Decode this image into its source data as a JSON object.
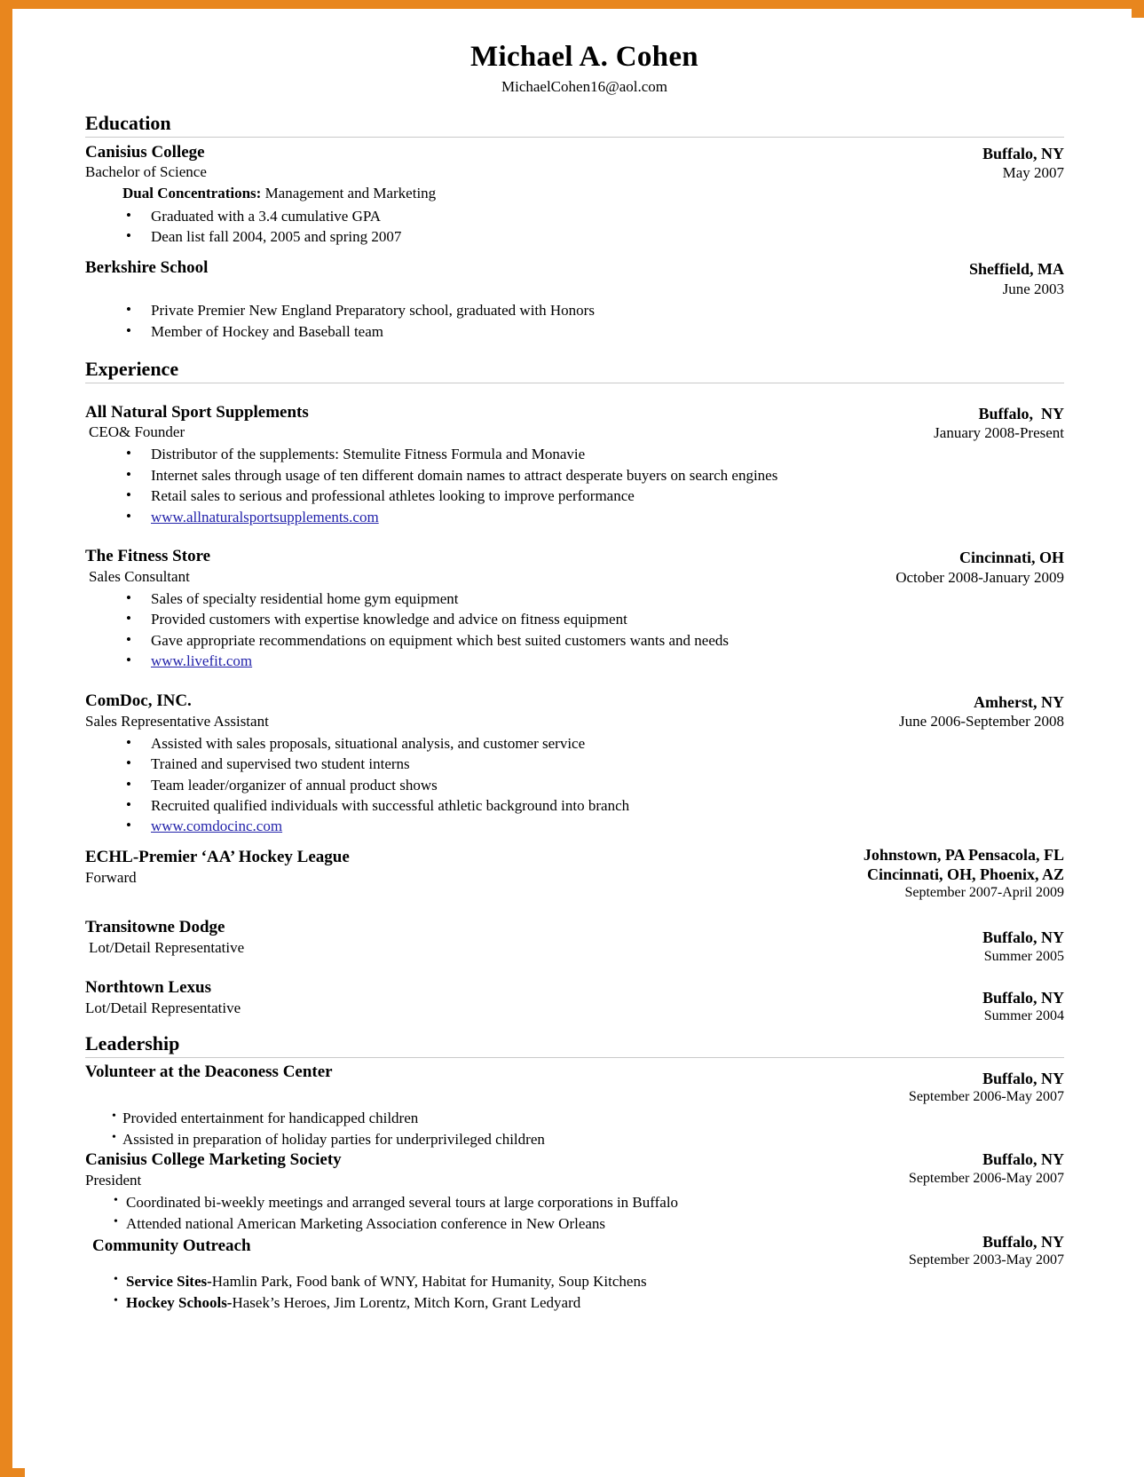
{
  "document": {
    "name": "Michael A. Cohen",
    "email": "MichaelCohen16@aol.com",
    "frame_color": "#e8861e",
    "link_color": "#2222aa"
  },
  "sections": {
    "education": {
      "title": "Education",
      "entries": [
        {
          "org": "Canisius College",
          "role": "Bachelor of Science",
          "location": "Buffalo, NY",
          "date": "May 2007",
          "sub_label": "Dual Concentrations:",
          "sub_text": " Management and Marketing",
          "bullets": [
            "Graduated with a 3.4 cumulative GPA",
            "Dean list fall 2004, 2005 and spring 2007"
          ]
        },
        {
          "org": "Berkshire School",
          "role": "",
          "location": "Sheffield, MA",
          "date": "June 2003",
          "bullets": [
            "Private Premier New England Preparatory school, graduated with Honors",
            "Member of Hockey and Baseball team"
          ]
        }
      ]
    },
    "experience": {
      "title": "Experience",
      "entries": [
        {
          "org": "All Natural Sport Supplements",
          "role": "CEO& Founder",
          "location": "Buffalo,  NY",
          "date": "January 2008-Present",
          "bullets": [
            "Distributor of the supplements: Stemulite Fitness Formula and Monavie",
            "Internet sales through usage of ten different domain names to attract desperate buyers on search engines",
            "Retail sales to serious and professional athletes looking to improve performance"
          ],
          "link": "www.allnaturalsportsupplements.com"
        },
        {
          "org": "The Fitness Store",
          "role": "Sales Consultant",
          "location": "Cincinnati, OH",
          "date": "October 2008-January 2009",
          "bullets": [
            "Sales of specialty residential home gym equipment",
            "Provided customers with expertise knowledge and advice on fitness equipment",
            "Gave appropriate recommendations on equipment which best suited customers wants and needs"
          ],
          "link": "www.livefit.com"
        },
        {
          "org": "ComDoc, INC.",
          "role": "Sales Representative Assistant",
          "location": "Amherst, NY",
          "date": "June 2006-September 2008",
          "bullets": [
            "Assisted with sales proposals, situational analysis, and customer service",
            "Trained and supervised two student interns",
            "Team leader/organizer of annual product shows",
            "Recruited qualified individuals with successful athletic background into branch"
          ],
          "link": "www.comdocinc.com"
        },
        {
          "org": "ECHL-Premier ‘AA’ Hockey League",
          "role": "Forward",
          "location_line1": "Johnstown, PA Pensacola, FL",
          "location_line2": "Cincinnati, OH, Phoenix, AZ",
          "date": "September 2007-April 2009",
          "bullets": []
        },
        {
          "org": "Transitowne Dodge",
          "role": "Lot/Detail Representative",
          "location": "Buffalo, NY",
          "date": "Summer 2005",
          "bullets": []
        },
        {
          "org": "Northtown Lexus",
          "role": "Lot/Detail Representative",
          "location": "Buffalo, NY",
          "date": "Summer 2004",
          "bullets": []
        }
      ]
    },
    "leadership": {
      "title": "Leadership",
      "entries": [
        {
          "org": "Volunteer at the Deaconess Center",
          "role": "",
          "location": "Buffalo, NY",
          "date": "September 2006-May 2007",
          "bullets": [
            "Provided entertainment for handicapped children",
            "Assisted in preparation of holiday parties for underprivileged children"
          ]
        },
        {
          "org": "Canisius College Marketing Society",
          "role": "President",
          "location": "Buffalo, NY",
          "date": "September 2006-May 2007",
          "bullets": [
            "Coordinated bi-weekly meetings and arranged several tours at large corporations in Buffalo",
            "Attended national American Marketing Association conference in New Orleans"
          ]
        },
        {
          "org": "Community Outreach",
          "role": "",
          "location": "Buffalo, NY",
          "date": "September 2003-May 2007",
          "rich_bullets": [
            {
              "label": "Service Sites-",
              "text": "Hamlin Park, Food bank of WNY, Habitat for Humanity, Soup Kitchens"
            },
            {
              "label": "Hockey Schools-",
              "text": "Hasek’s Heroes, Jim Lorentz, Mitch Korn, Grant Ledyard"
            }
          ]
        }
      ]
    }
  }
}
